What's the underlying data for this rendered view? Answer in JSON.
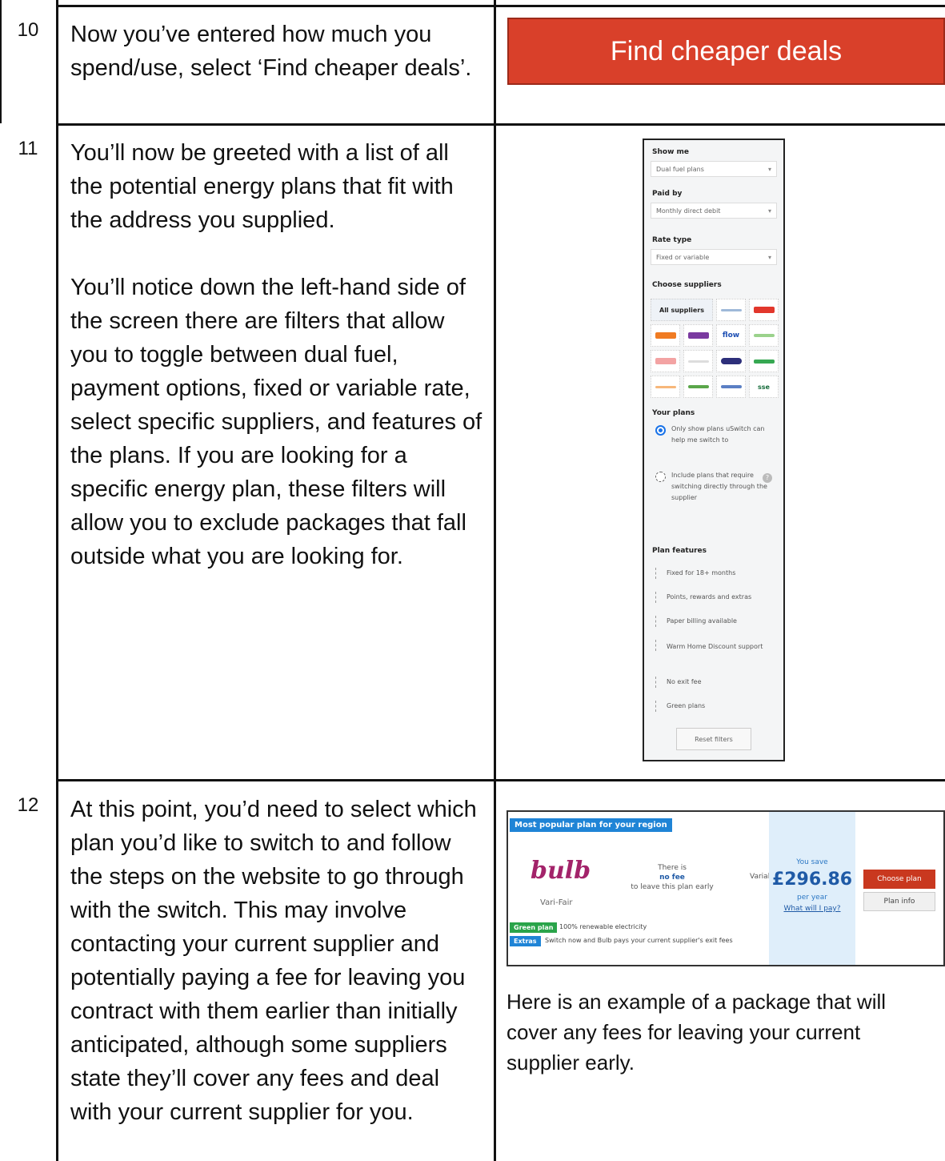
{
  "steps": [
    {
      "number": "10",
      "text": [
        "Now you’ve entered how much you spend/use, select ‘Find cheaper deals’."
      ]
    },
    {
      "number": "11",
      "text": [
        "You’ll now be greeted with a list of all the potential energy plans that fit with the address you supplied.",
        "You’ll notice down the left-hand side of the screen there are filters that allow you to toggle between dual fuel, payment options, fixed or variable rate, select specific suppliers, and features of the plans. If you are looking for a specific energy plan, these filters will allow you to exclude packages that fall outside what you are looking for."
      ]
    },
    {
      "number": "12",
      "text": [
        "At this point, you’d need to select which plan you’d like to switch to and follow the steps on the website to go through with the switch. This may involve contacting your current supplier and potentially paying a fee for leaving you contract with them earlier than initially anticipated, although some suppliers state they’ll cover any fees and deal with your current supplier for you."
      ]
    }
  ],
  "find_button": {
    "label": "Find cheaper deals",
    "color": "#d9402a"
  },
  "filters": {
    "show_me": {
      "heading": "Show me",
      "value": "Dual fuel plans"
    },
    "paid_by": {
      "heading": "Paid by",
      "value": "Monthly direct debit"
    },
    "rate_type": {
      "heading": "Rate type",
      "value": "Fixed or variable"
    },
    "suppliers": {
      "heading": "Choose suppliers",
      "all_label": "All suppliers",
      "flow_label": "flow",
      "sse_label": "sse"
    },
    "your_plans": {
      "heading": "Your plans",
      "options": [
        "Only show plans uSwitch can help me switch to",
        "Include plans that require switching directly through the supplier"
      ]
    },
    "plan_features": {
      "heading": "Plan features",
      "options": [
        "Fixed for 18+ months",
        "Points, rewards and extras",
        "Paper billing available",
        "Warm Home Discount support",
        "No exit fee",
        "Green plans"
      ]
    },
    "reset_label": "Reset filters"
  },
  "plan_card": {
    "tag": "Most popular plan for your region",
    "supplier_logo": "bulb",
    "plan_name": "Vari-Fair",
    "fee_line1": "There is",
    "fee_line2": "no fee",
    "fee_line3": "to leave this plan early",
    "rate": "Variable",
    "you_save": "You save",
    "saving": "£296.86",
    "per_year": "per year",
    "what_link": "What will I pay?",
    "choose_label": "Choose plan",
    "info_label": "Plan info",
    "green_tag": "Green plan",
    "green_text": "100% renewable electricity",
    "extras_tag": "Extras",
    "extras_text": "Switch now and Bulb pays your current supplier's exit fees"
  },
  "caption": "Here is an example of a package that will cover any fees for leaving your current supplier early."
}
